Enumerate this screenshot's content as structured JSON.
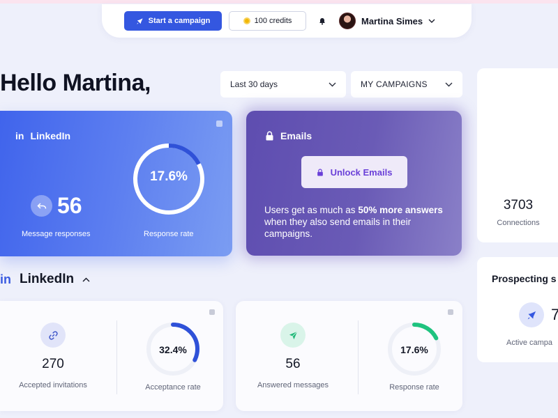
{
  "topbar": {
    "start_campaign_label": "Start a campaign",
    "credits_label": "100 credits",
    "user_name": "Martina Simes"
  },
  "greeting": "Hello Martina,",
  "filters": {
    "period": "Last 30 days",
    "campaigns": "MY CAMPAIGNS"
  },
  "linkedin_card": {
    "title": "LinkedIn",
    "message_responses_value": "56",
    "message_responses_label": "Message responses",
    "response_rate_value": "17.6%",
    "response_rate_fraction": 0.176,
    "response_rate_label": "Response rate"
  },
  "emails_card": {
    "title": "Emails",
    "unlock_label": "Unlock Emails",
    "desc_part1": "Users get as much as ",
    "desc_bold": "50% more answers",
    "desc_part2": " when they also send emails in their campaigns."
  },
  "side": {
    "connections_value": "3703",
    "connections_label": "Connections",
    "prospecting_title": "Prospecting s",
    "active_value": "7",
    "active_label": "Active campa"
  },
  "linkedin_section": {
    "title": "LinkedIn"
  },
  "stats": {
    "accepted_invitations_value": "270",
    "accepted_invitations_label": "Accepted invitations",
    "acceptance_rate_value": "32.4%",
    "acceptance_rate_fraction": 0.324,
    "acceptance_rate_label": "Acceptance rate",
    "answered_messages_value": "56",
    "answered_messages_label": "Answered messages",
    "response_rate_value": "17.6%",
    "response_rate_fraction": 0.176,
    "response_rate_label": "Response rate"
  },
  "colors": {
    "accent_blue": "#3457e0",
    "gauge_blue": "#2f51d8",
    "gauge_green": "#1fc37f",
    "email_purple": "#6a5bb6"
  },
  "icons": {
    "campaign": "rocket-icon",
    "credits": "coin-icon",
    "notifications": "bell-icon",
    "linkedin": "linkedin-icon",
    "emails": "lock-icon",
    "responses": "reply-icon",
    "invitations": "link-icon",
    "messages": "send-icon",
    "active": "rocket-icon"
  }
}
